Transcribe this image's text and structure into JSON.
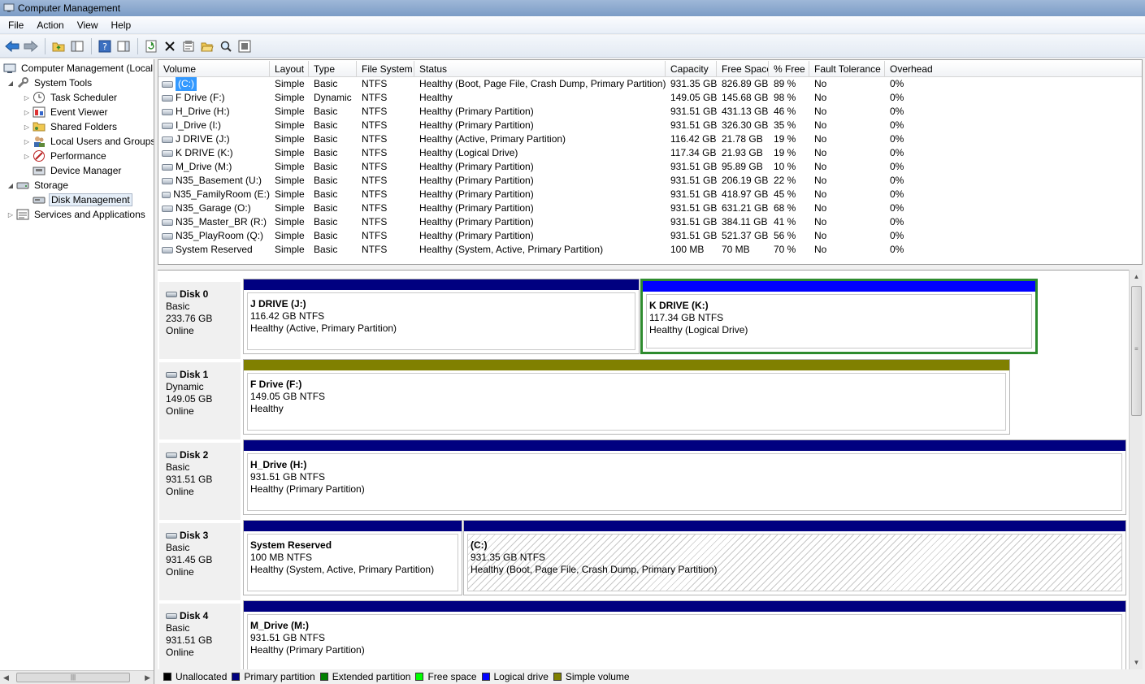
{
  "window": {
    "title": "Computer Management"
  },
  "menu": [
    "File",
    "Action",
    "View",
    "Help"
  ],
  "toolbar": {
    "icons": [
      "back-arrow-icon",
      "forward-arrow-icon",
      "up-folder-icon",
      "show-hide-tree-icon",
      "help-icon",
      "properties-icon",
      "refresh-icon",
      "delete-icon",
      "properties-sheet-icon",
      "open-folder-icon",
      "search-icon",
      "help-topic-icon"
    ]
  },
  "tree": {
    "root": "Computer Management (Local",
    "system_tools": "System Tools",
    "task_scheduler": "Task Scheduler",
    "event_viewer": "Event Viewer",
    "shared_folders": "Shared Folders",
    "local_users": "Local Users and Groups",
    "performance": "Performance",
    "device_manager": "Device Manager",
    "storage": "Storage",
    "disk_management": "Disk Management",
    "services": "Services and Applications"
  },
  "list": {
    "columns": [
      "Volume",
      "Layout",
      "Type",
      "File System",
      "Status",
      "Capacity",
      "Free Space",
      "% Free",
      "Fault Tolerance",
      "Overhead"
    ],
    "rows": [
      [
        "(C:)",
        "Simple",
        "Basic",
        "NTFS",
        "Healthy (Boot, Page File, Crash Dump, Primary Partition)",
        "931.35 GB",
        "826.89 GB",
        "89 %",
        "No",
        "0%"
      ],
      [
        "F Drive (F:)",
        "Simple",
        "Dynamic",
        "NTFS",
        "Healthy",
        "149.05 GB",
        "145.68 GB",
        "98 %",
        "No",
        "0%"
      ],
      [
        "H_Drive (H:)",
        "Simple",
        "Basic",
        "NTFS",
        "Healthy (Primary Partition)",
        "931.51 GB",
        "431.13 GB",
        "46 %",
        "No",
        "0%"
      ],
      [
        "I_Drive (I:)",
        "Simple",
        "Basic",
        "NTFS",
        "Healthy (Primary Partition)",
        "931.51 GB",
        "326.30 GB",
        "35 %",
        "No",
        "0%"
      ],
      [
        "J DRIVE (J:)",
        "Simple",
        "Basic",
        "NTFS",
        "Healthy (Active, Primary Partition)",
        "116.42 GB",
        "21.78 GB",
        "19 %",
        "No",
        "0%"
      ],
      [
        "K DRIVE (K:)",
        "Simple",
        "Basic",
        "NTFS",
        "Healthy (Logical Drive)",
        "117.34 GB",
        "21.93 GB",
        "19 %",
        "No",
        "0%"
      ],
      [
        "M_Drive (M:)",
        "Simple",
        "Basic",
        "NTFS",
        "Healthy (Primary Partition)",
        "931.51 GB",
        "95.89 GB",
        "10 %",
        "No",
        "0%"
      ],
      [
        "N35_Basement (U:)",
        "Simple",
        "Basic",
        "NTFS",
        "Healthy (Primary Partition)",
        "931.51 GB",
        "206.19 GB",
        "22 %",
        "No",
        "0%"
      ],
      [
        "N35_FamilyRoom (E:)",
        "Simple",
        "Basic",
        "NTFS",
        "Healthy (Primary Partition)",
        "931.51 GB",
        "418.97 GB",
        "45 %",
        "No",
        "0%"
      ],
      [
        "N35_Garage (O:)",
        "Simple",
        "Basic",
        "NTFS",
        "Healthy (Primary Partition)",
        "931.51 GB",
        "631.21 GB",
        "68 %",
        "No",
        "0%"
      ],
      [
        "N35_Master_BR (R:)",
        "Simple",
        "Basic",
        "NTFS",
        "Healthy (Primary Partition)",
        "931.51 GB",
        "384.11 GB",
        "41 %",
        "No",
        "0%"
      ],
      [
        "N35_PlayRoom (Q:)",
        "Simple",
        "Basic",
        "NTFS",
        "Healthy (Primary Partition)",
        "931.51 GB",
        "521.37 GB",
        "56 %",
        "No",
        "0%"
      ],
      [
        "System Reserved",
        "Simple",
        "Basic",
        "NTFS",
        "Healthy (System, Active, Primary Partition)",
        "100 MB",
        "70 MB",
        "70 %",
        "No",
        "0%"
      ]
    ]
  },
  "disks": [
    {
      "name": "Disk 0",
      "type": "Basic",
      "size": "233.76 GB",
      "status": "Online",
      "partitions": [
        {
          "name": "J DRIVE  (J:)",
          "size": "116.42 GB NTFS",
          "status": "Healthy (Active, Primary Partition)"
        },
        {
          "name": "K DRIVE  (K:)",
          "size": "117.34 GB NTFS",
          "status": "Healthy (Logical Drive)"
        }
      ]
    },
    {
      "name": "Disk 1",
      "type": "Dynamic",
      "size": "149.05 GB",
      "status": "Online",
      "partitions": [
        {
          "name": "F Drive  (F:)",
          "size": "149.05 GB NTFS",
          "status": "Healthy"
        }
      ]
    },
    {
      "name": "Disk 2",
      "type": "Basic",
      "size": "931.51 GB",
      "status": "Online",
      "partitions": [
        {
          "name": "H_Drive  (H:)",
          "size": "931.51 GB NTFS",
          "status": "Healthy (Primary Partition)"
        }
      ]
    },
    {
      "name": "Disk 3",
      "type": "Basic",
      "size": "931.45 GB",
      "status": "Online",
      "partitions": [
        {
          "name": "System Reserved",
          "size": "100 MB NTFS",
          "status": "Healthy (System, Active, Primary Partition)"
        },
        {
          "name": "(C:)",
          "size": "931.35 GB NTFS",
          "status": "Healthy (Boot, Page File, Crash Dump, Primary Partition)"
        }
      ]
    },
    {
      "name": "Disk 4",
      "type": "Basic",
      "size": "931.51 GB",
      "status": "Online",
      "partitions": [
        {
          "name": "M_Drive  (M:)",
          "size": "931.51 GB NTFS",
          "status": "Healthy (Primary Partition)"
        }
      ]
    }
  ],
  "legend": [
    {
      "label": "Unallocated",
      "color": "#000000"
    },
    {
      "label": "Primary partition",
      "color": "#000080"
    },
    {
      "label": "Extended partition",
      "color": "#008000"
    },
    {
      "label": "Free space",
      "color": "#00ff00"
    },
    {
      "label": "Logical drive",
      "color": "#0000ff"
    },
    {
      "label": "Simple volume",
      "color": "#808000"
    }
  ],
  "colors": {
    "primary": "#000080",
    "logical": "#0000ff",
    "simple": "#808000",
    "extended": "#008000"
  }
}
